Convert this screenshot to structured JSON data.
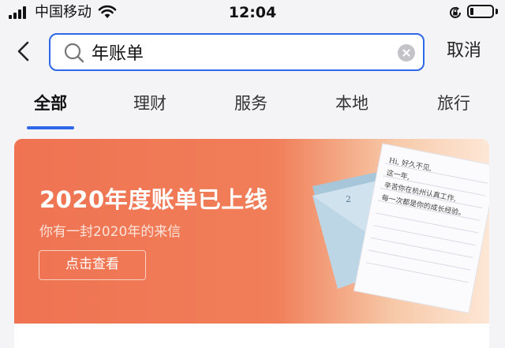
{
  "status_bar": {
    "carrier": "中国移动",
    "time": "12:04",
    "battery_level": 0.15
  },
  "search": {
    "query": "年账单",
    "cancel_label": "取消"
  },
  "tabs": [
    {
      "label": "全部",
      "active": true
    },
    {
      "label": "理财",
      "active": false
    },
    {
      "label": "服务",
      "active": false
    },
    {
      "label": "本地",
      "active": false
    },
    {
      "label": "旅行",
      "active": false
    }
  ],
  "banner": {
    "title": "2020年度账单已上线",
    "subtitle": "你有一封2020年的来信",
    "button_label": "点击查看",
    "letter_lines": [
      "Hi, 好久不见,",
      "这一年,",
      "辛苦你在杭州认真工作,",
      "每一次都是你的成长经验。"
    ],
    "envelope_number": "2"
  },
  "colors": {
    "accent": "#2f67e9",
    "banner": "#ef7352"
  },
  "icons": [
    "signal-icon",
    "wifi-icon",
    "rotation-lock-icon",
    "battery-icon",
    "back-chevron-icon",
    "search-icon",
    "clear-icon"
  ]
}
